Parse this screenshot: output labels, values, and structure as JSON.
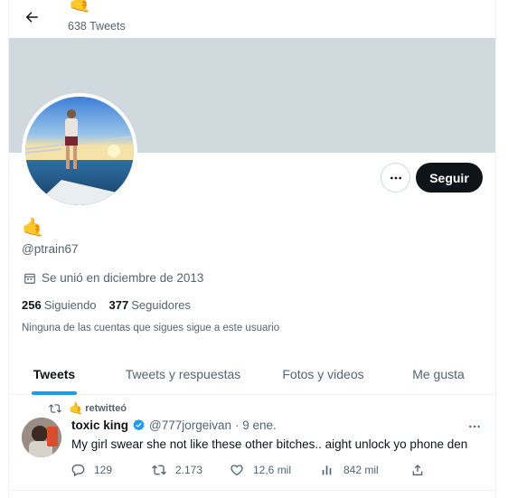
{
  "header": {
    "name_emoji": "🤙",
    "tweet_count": "638 Tweets"
  },
  "profile": {
    "name_emoji": "🤙",
    "handle": "@ptrain67",
    "joined": "Se unió en diciembre de 2013",
    "following_count": "256",
    "following_label": "Siguiendo",
    "followers_count": "377",
    "followers_label": "Seguidores",
    "not_followed_note": "Ninguna de las cuentas que sigues sigue a este usuario",
    "follow_label": "Seguir"
  },
  "tabs": [
    {
      "label": "Tweets",
      "active": true
    },
    {
      "label": "Tweets y respuestas",
      "active": false
    },
    {
      "label": "Fotos y videos",
      "active": false
    },
    {
      "label": "Me gusta",
      "active": false
    }
  ],
  "tweet": {
    "retweet_emoji": "🤙",
    "retweet_label": "retwitteó",
    "author_name": "toxic king",
    "author_handle": "@777jorgeivan",
    "date": "· 9 ene.",
    "text": "My girl swear she not like these other bitches.. aight unlock yo phone den",
    "replies": "129",
    "retweets": "2.173",
    "likes": "12,6 mil",
    "views": "842 mil"
  },
  "colors": {
    "accent": "#1d9bf0",
    "banner": "#cfd9de",
    "follow_button": "#0f1419",
    "secondary_text": "#536471"
  },
  "icons": [
    "back-arrow-icon",
    "more-horizontal-icon",
    "calendar-icon",
    "retweet-icon",
    "verified-badge-icon",
    "reply-icon",
    "like-icon",
    "views-icon",
    "share-icon"
  ]
}
